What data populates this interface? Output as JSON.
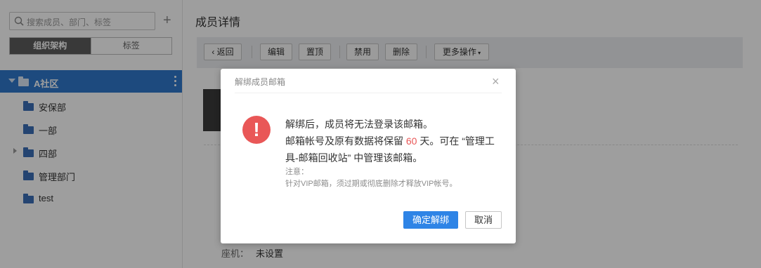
{
  "sidebar": {
    "search_placeholder": "搜索成员、部门、标签",
    "add_symbol": "+",
    "tabs": [
      {
        "label": "组织架构"
      },
      {
        "label": "标签"
      }
    ],
    "tree": {
      "root": {
        "label": "A社区"
      },
      "items": [
        {
          "label": "安保部"
        },
        {
          "label": "一部"
        },
        {
          "label": "四部"
        },
        {
          "label": "管理部门"
        },
        {
          "label": "test"
        }
      ]
    }
  },
  "main": {
    "title": "成员详情",
    "toolbar": {
      "back": "返回",
      "edit": "编辑",
      "pin": "置顶",
      "disable": "禁用",
      "delete": "删除",
      "more": "更多操作"
    },
    "fields": [
      {
        "label": "座机：",
        "value": "未设置"
      }
    ]
  },
  "dialog": {
    "title": "解绑成员邮箱",
    "close_symbol": "×",
    "warn_symbol": "!",
    "message_line1": "解绑后，成员将无法登录该邮箱。",
    "message_line2_pre": "邮箱帐号及原有数据将保留 ",
    "retain_days": "60",
    "message_line2_post": " 天。可在 “管理工具-邮箱回收站” 中管理该邮箱。",
    "note_title": "注意：",
    "note_text": "针对VIP邮箱，须过期或彻底删除才释放VIP帐号。",
    "confirm_label": "确定解绑",
    "cancel_label": "取消",
    "colors": {
      "primary": "#2e84e6",
      "danger": "#e95757"
    }
  }
}
